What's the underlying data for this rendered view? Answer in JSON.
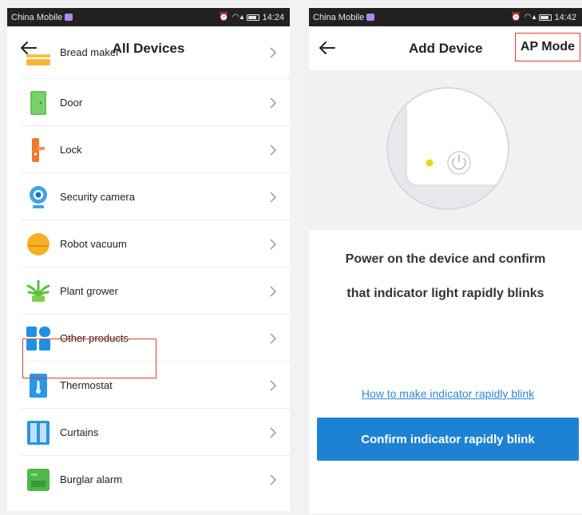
{
  "left": {
    "status": {
      "carrier": "China Mobile",
      "time": "14:24"
    },
    "title": "All Devices",
    "devices": [
      {
        "label": "Bread maker",
        "icon": "bread-maker-icon"
      },
      {
        "label": "Door",
        "icon": "door-icon"
      },
      {
        "label": "Lock",
        "icon": "lock-icon"
      },
      {
        "label": "Security camera",
        "icon": "security-camera-icon"
      },
      {
        "label": "Robot vacuum",
        "icon": "robot-vacuum-icon"
      },
      {
        "label": "Plant grower",
        "icon": "plant-grower-icon"
      },
      {
        "label": "Other products",
        "icon": "other-products-icon",
        "highlighted": true
      },
      {
        "label": "Thermostat",
        "icon": "thermostat-icon"
      },
      {
        "label": "Curtains",
        "icon": "curtains-icon"
      },
      {
        "label": "Burglar alarm",
        "icon": "burglar-alarm-icon"
      }
    ]
  },
  "right": {
    "status": {
      "carrier": "China Mobile",
      "time": "14:42"
    },
    "title": "Add Device",
    "ap_mode_label": "AP Mode",
    "instruction_line1": "Power on the device and confirm",
    "instruction_line2": "that indicator light rapidly blinks",
    "help_link": "How to make indicator rapidly blink",
    "confirm_button": "Confirm indicator rapidly blink"
  },
  "colors": {
    "accent_blue": "#1e82d2",
    "link_blue": "#2f86d6",
    "highlight_red": "#e43b3b",
    "indicator_yellow": "#f3d21a"
  }
}
